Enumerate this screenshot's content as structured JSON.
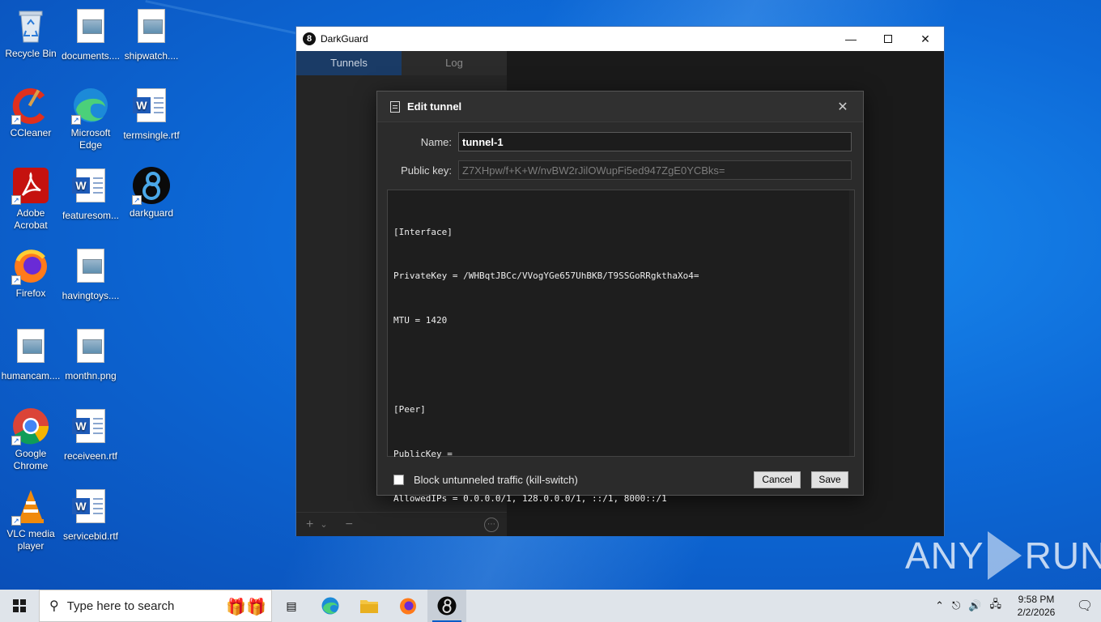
{
  "desktop": {
    "icons": [
      {
        "label": "Recycle Bin",
        "icon": "recycle-bin-icon"
      },
      {
        "label": "documents....",
        "icon": "image-file-icon"
      },
      {
        "label": "shipwatch....",
        "icon": "image-file-icon"
      },
      {
        "label": "CCleaner",
        "icon": "ccleaner-icon"
      },
      {
        "label": "Microsoft Edge",
        "icon": "edge-icon"
      },
      {
        "label": "termsingle.rtf",
        "icon": "word-doc-icon"
      },
      {
        "label": "Adobe Acrobat",
        "icon": "acrobat-icon"
      },
      {
        "label": "featuresom...",
        "icon": "word-doc-icon"
      },
      {
        "label": "darkguard",
        "icon": "darkguard-icon"
      },
      {
        "label": "Firefox",
        "icon": "firefox-icon"
      },
      {
        "label": "havingtoys....",
        "icon": "image-file-icon"
      },
      {
        "label": "humancam....",
        "icon": "image-file-icon"
      },
      {
        "label": "monthn.png",
        "icon": "image-file-icon"
      },
      {
        "label": "Google Chrome",
        "icon": "chrome-icon"
      },
      {
        "label": "receiveen.rtf",
        "icon": "word-doc-icon"
      },
      {
        "label": "VLC media player",
        "icon": "vlc-icon"
      },
      {
        "label": "servicebid.rtf",
        "icon": "word-doc-icon"
      }
    ]
  },
  "window": {
    "title": "DarkGuard",
    "tabs": [
      {
        "label": "Tunnels",
        "active": true
      },
      {
        "label": "Log",
        "active": false
      }
    ],
    "footer": {
      "add": "+",
      "dropdown": "⌄",
      "remove": "−",
      "more": "⋯"
    }
  },
  "dialog": {
    "title": "Edit tunnel",
    "name_label": "Name:",
    "name_value": "tunnel-1",
    "pubkey_label": "Public key:",
    "pubkey_value": "Z7XHpw/f+K+W/nvBW2rJilOWupFi5ed947ZgE0YCBks=",
    "config_lines": [
      "[Interface]",
      "PrivateKey = /WHBqtJBCc/VVogYGe657UhBKB/T9SSGoRRgkthaXo4=",
      "MTU = 1420",
      "",
      "[Peer]",
      "PublicKey =",
      "AllowedIPs = 0.0.0.0/1, 128.0.0.0/1, ::/1, 8000::/1"
    ],
    "killswitch_label": "Block untunneled traffic (kill-switch)",
    "killswitch_checked": false,
    "cancel_label": "Cancel",
    "save_label": "Save"
  },
  "watermark": {
    "left": "ANY",
    "right": "RUN"
  },
  "taskbar": {
    "search_placeholder": "Type here to search",
    "apps": [
      "task-view-icon",
      "edge-icon",
      "file-explorer-icon",
      "firefox-icon",
      "darkguard-icon"
    ],
    "clock_time": "9:58 PM",
    "clock_date": "2/2/2026"
  }
}
